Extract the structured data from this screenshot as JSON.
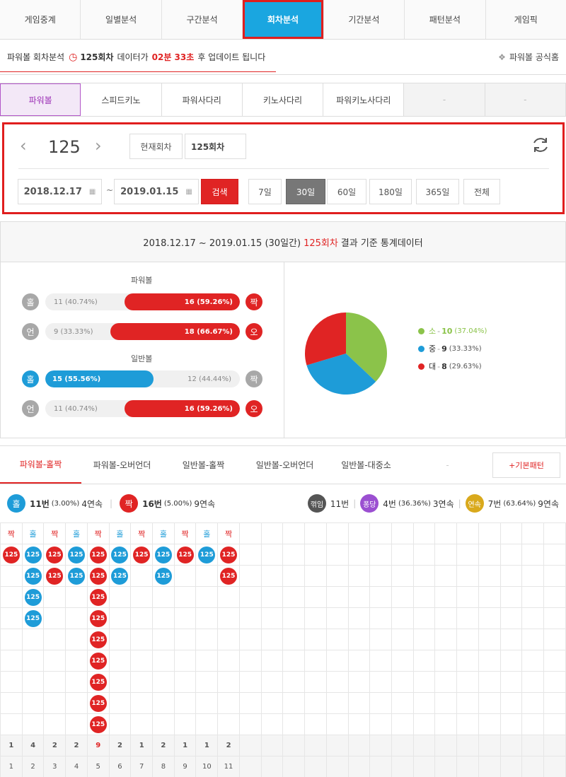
{
  "top_nav": {
    "tabs": [
      "게임중계",
      "일별분석",
      "구간분석",
      "회차분석",
      "기간분석",
      "패턴분석",
      "게임픽"
    ],
    "active_index": 3
  },
  "info_bar": {
    "prefix": "파워볼 회차분석",
    "round": "125회차",
    "mid": "데이터가",
    "countdown": "02분 33초",
    "suffix": "후 업데이트 됩니다",
    "home_link": "파워볼 공식홈"
  },
  "game_tabs": [
    "파워볼",
    "스피드키노",
    "파워사다리",
    "키노사다리",
    "파워키노사다리",
    "-",
    "-"
  ],
  "control": {
    "round_number": "125",
    "current_round_btn": "현재회차",
    "round_input": "125회차",
    "date_from": "2018.12.17",
    "date_to": "2019.01.15",
    "tilde": "~",
    "search_btn": "검색",
    "periods": [
      "7일",
      "30일",
      "60일",
      "180일",
      "365일",
      "전체"
    ],
    "active_period": "30일"
  },
  "stats_header": {
    "range": "2018.12.17 ~ 2019.01.15 (30일간)",
    "round": "125회차",
    "suffix": "결과 기준 통계데이터"
  },
  "stats": {
    "powerball_title": "파워볼",
    "normalball_title": "일반볼",
    "rows": [
      {
        "left_icon": "홀",
        "left_count": "11",
        "left_pct": "(40.74%)",
        "right_count": "16",
        "right_pct": "(59.26%)",
        "right_icon": "짝",
        "fill_side": "right",
        "fill_ratio": 0.5926,
        "color": "#e02424",
        "left_icon_color": "#a8a8a8",
        "right_icon_color": "#e02424"
      },
      {
        "left_icon": "언",
        "left_count": "9",
        "left_pct": "(33.33%)",
        "right_count": "18",
        "right_pct": "(66.67%)",
        "right_icon": "오",
        "fill_side": "right",
        "fill_ratio": 0.6667,
        "color": "#e02424",
        "left_icon_color": "#a8a8a8",
        "right_icon_color": "#e02424"
      },
      {
        "left_icon": "홀",
        "left_count": "15",
        "left_pct": "(55.56%)",
        "right_count": "12",
        "right_pct": "(44.44%)",
        "right_icon": "짝",
        "fill_side": "left",
        "fill_ratio": 0.5556,
        "color": "#1e9cd8",
        "left_icon_color": "#1e9cd8",
        "right_icon_color": "#a8a8a8"
      },
      {
        "left_icon": "언",
        "left_count": "11",
        "left_pct": "(40.74%)",
        "right_count": "16",
        "right_pct": "(59.26%)",
        "right_icon": "오",
        "fill_side": "right",
        "fill_ratio": 0.5926,
        "color": "#e02424",
        "left_icon_color": "#a8a8a8",
        "right_icon_color": "#e02424"
      }
    ],
    "pie": [
      {
        "label": "소",
        "count": "10",
        "pct": "(37.04%)",
        "value": 10,
        "color": "#8bc34a"
      },
      {
        "label": "중",
        "count": "9",
        "pct": "(33.33%)",
        "value": 9,
        "color": "#1e9cd8"
      },
      {
        "label": "대",
        "count": "8",
        "pct": "(29.63%)",
        "value": 8,
        "color": "#e02424"
      }
    ]
  },
  "pattern_tabs": [
    "파워볼-홀짝",
    "파워볼-오버언더",
    "일반볼-홀짝",
    "일반볼-오버언더",
    "일반볼-대중소",
    "-"
  ],
  "pattern_btn": "+기본패턴",
  "summary": {
    "odd_icon": "홀",
    "odd_text": "11번",
    "odd_pct": "(3.00%)",
    "odd_streak": "4연속",
    "even_icon": "짝",
    "even_text": "16번",
    "even_pct": "(5.00%)",
    "even_streak": "9연속",
    "break_icon": "꺾임",
    "break_text": "11번",
    "pong_icon": "퐁당",
    "pong_text": "4번",
    "pong_pct": "(36.36%)",
    "pong_streak": "3연속",
    "cont_icon": "연속",
    "cont_text": "7번",
    "cont_pct": "(63.64%)",
    "cont_streak": "9연속",
    "sep": "|"
  },
  "grid": {
    "ball_label": "125",
    "columns": [
      {
        "head": "짝",
        "color": "r",
        "count": 1
      },
      {
        "head": "홀",
        "color": "b",
        "count": 4
      },
      {
        "head": "짝",
        "color": "r",
        "count": 2
      },
      {
        "head": "홀",
        "color": "b",
        "count": 2
      },
      {
        "head": "짝",
        "color": "r",
        "count": 9
      },
      {
        "head": "홀",
        "color": "b",
        "count": 2
      },
      {
        "head": "짝",
        "color": "r",
        "count": 1
      },
      {
        "head": "홀",
        "color": "b",
        "count": 2
      },
      {
        "head": "짝",
        "color": "r",
        "count": 1
      },
      {
        "head": "홀",
        "color": "b",
        "count": 1
      },
      {
        "head": "짝",
        "color": "r",
        "count": 2
      }
    ],
    "total_columns": 26,
    "ball_rows": 9,
    "counts_row": [
      "1",
      "4",
      "2",
      "2",
      "9",
      "2",
      "1",
      "2",
      "1",
      "1",
      "2"
    ],
    "index_row": [
      "1",
      "2",
      "3",
      "4",
      "5",
      "6",
      "7",
      "8",
      "9",
      "10",
      "11"
    ]
  }
}
